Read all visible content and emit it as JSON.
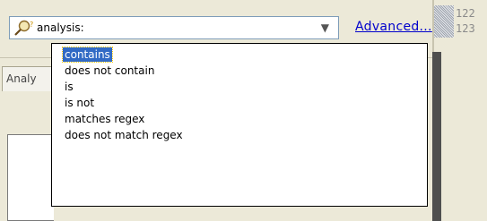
{
  "filter": {
    "value": "analysis:",
    "advanced_link": "Advanced..."
  },
  "gutter": {
    "line_numbers": [
      "122",
      "123"
    ]
  },
  "tabs": {
    "first_label": "Analy"
  },
  "dropdown": {
    "options": [
      "contains",
      "does not contain",
      "is",
      "is not",
      "matches regex",
      "does not match regex"
    ],
    "selected": "contains"
  },
  "colors": {
    "selection": "#316ac5",
    "link": "#0000cc",
    "window_bg": "#ece9d8"
  }
}
